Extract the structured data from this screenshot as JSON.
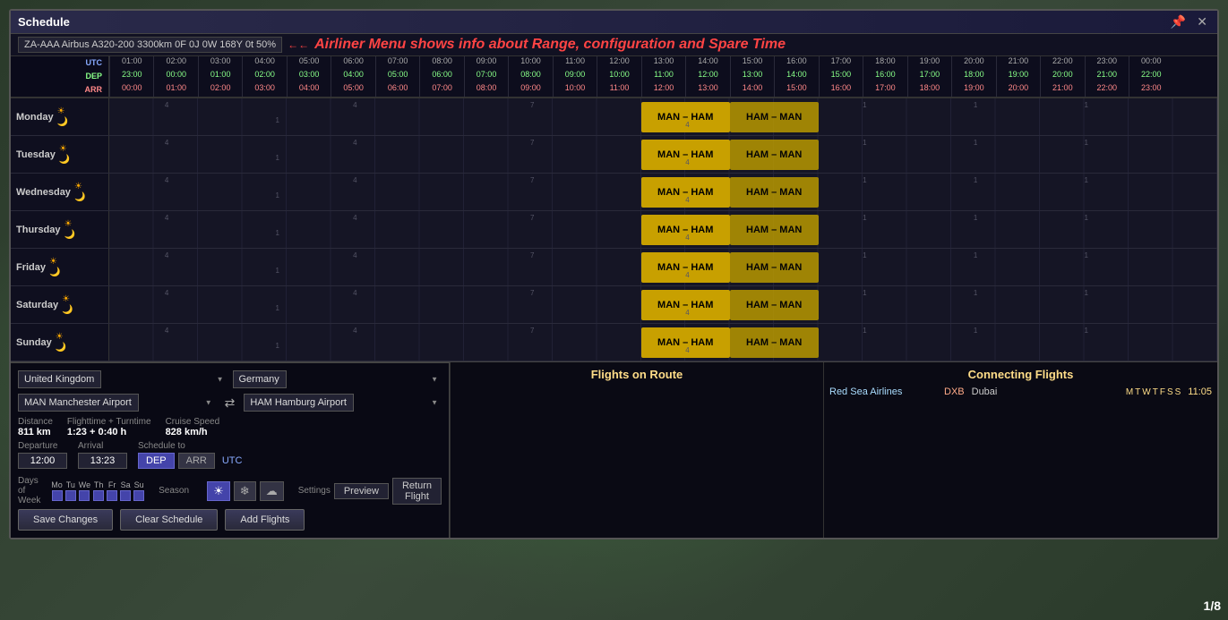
{
  "window": {
    "title": "Schedule",
    "controls": [
      "pin-icon",
      "close-icon"
    ]
  },
  "airliner": {
    "info": "ZA-AAA  Airbus A320-200  3300km  0F 0J 0W 168Y 0t  50%"
  },
  "annotation": {
    "arrow": "←←",
    "text": "Airliner Menu shows info about Range, configuration and Spare Time"
  },
  "time_header": {
    "utc_label": "UTC",
    "dep_label": "DEP",
    "arr_label": "ARR",
    "times": [
      {
        "utc": "01:00",
        "dep": "23:00",
        "arr": "00:00"
      },
      {
        "utc": "02:00",
        "dep": "00:00",
        "arr": "01:00"
      },
      {
        "utc": "03:00",
        "dep": "01:00",
        "arr": "02:00"
      },
      {
        "utc": "04:00",
        "dep": "02:00",
        "arr": "03:00"
      },
      {
        "utc": "05:00",
        "dep": "03:00",
        "arr": "04:00"
      },
      {
        "utc": "06:00",
        "dep": "04:00",
        "arr": "05:00"
      },
      {
        "utc": "07:00",
        "dep": "05:00",
        "arr": "06:00"
      },
      {
        "utc": "08:00",
        "dep": "06:00",
        "arr": "07:00"
      },
      {
        "utc": "09:00",
        "dep": "07:00",
        "arr": "08:00"
      },
      {
        "utc": "10:00",
        "dep": "08:00",
        "arr": "09:00"
      },
      {
        "utc": "11:00",
        "dep": "09:00",
        "arr": "10:00"
      },
      {
        "utc": "12:00",
        "dep": "10:00",
        "arr": "11:00"
      },
      {
        "utc": "13:00",
        "dep": "11:00",
        "arr": "12:00"
      },
      {
        "utc": "14:00",
        "dep": "12:00",
        "arr": "13:00"
      },
      {
        "utc": "15:00",
        "dep": "13:00",
        "arr": "14:00"
      },
      {
        "utc": "16:00",
        "dep": "14:00",
        "arr": "15:00"
      },
      {
        "utc": "17:00",
        "dep": "15:00",
        "arr": "16:00"
      },
      {
        "utc": "18:00",
        "dep": "16:00",
        "arr": "17:00"
      },
      {
        "utc": "19:00",
        "dep": "17:00",
        "arr": "18:00"
      },
      {
        "utc": "20:00",
        "dep": "18:00",
        "arr": "19:00"
      },
      {
        "utc": "21:00",
        "dep": "19:00",
        "arr": "20:00"
      },
      {
        "utc": "22:00",
        "dep": "20:00",
        "arr": "21:00"
      },
      {
        "utc": "23:00",
        "dep": "21:00",
        "arr": "22:00"
      },
      {
        "utc": "00:00",
        "dep": "22:00",
        "arr": "23:00"
      }
    ]
  },
  "days": [
    {
      "name": "Monday",
      "flight_out": "MAN – HAM",
      "flight_ret": "HAM – MAN"
    },
    {
      "name": "Tuesday",
      "flight_out": "MAN – HAM",
      "flight_ret": "HAM – MAN"
    },
    {
      "name": "Wednesday",
      "flight_out": "MAN – HAM",
      "flight_ret": "HAM – MAN"
    },
    {
      "name": "Thursday",
      "flight_out": "MAN – HAM",
      "flight_ret": "HAM – MAN"
    },
    {
      "name": "Friday",
      "flight_out": "MAN – HAM",
      "flight_ret": "HAM – MAN"
    },
    {
      "name": "Saturday",
      "flight_out": "MAN – HAM",
      "flight_ret": "HAM – MAN"
    },
    {
      "name": "Sunday",
      "flight_out": "MAN – HAM",
      "flight_ret": "HAM – MAN"
    }
  ],
  "bottom_panel": {
    "origin_country": "United Kingdom",
    "dest_country": "Germany",
    "origin_airport": "MAN  Manchester Airport",
    "dest_airport": "HAM  Hamburg Airport",
    "distance_label": "Distance",
    "distance_value": "811 km",
    "flighttime_label": "Flighttime + Turntime",
    "flighttime_value": "1:23 + 0:40 h",
    "cruise_speed_label": "Cruise Speed",
    "cruise_speed_value": "828 km/h",
    "departure_label": "Departure",
    "departure_value": "12:00",
    "arrival_label": "Arrival",
    "arrival_value": "13:23",
    "schedule_to_label": "Schedule to",
    "dep_btn": "DEP",
    "arr_btn": "ARR",
    "utc_btn": "UTC",
    "days_label": "Days of Week",
    "days": [
      "Mo",
      "Tu",
      "We",
      "Th",
      "Fr",
      "Sa",
      "Su"
    ],
    "season_label": "Season",
    "season_buttons": [
      "☀",
      "❄",
      "☁"
    ],
    "settings_label": "Settings",
    "preview_btn": "Preview",
    "return_flight_btn": "Return Flight",
    "save_btn": "Save Changes",
    "clear_btn": "Clear Schedule",
    "add_btn": "Add Flights"
  },
  "flights_on_route": {
    "title": "Flights on Route"
  },
  "connecting_flights": {
    "title": "Connecting Flights",
    "flights": [
      {
        "airline": "Red Sea Airlines",
        "code": "DXB",
        "city": "Dubai",
        "days": [
          "M",
          "T",
          "W",
          "T",
          "F",
          "S",
          "S"
        ],
        "active_days": [
          0,
          1,
          2,
          3,
          4,
          5,
          6
        ],
        "time": "11:05"
      }
    ]
  },
  "page_counter": "1/8"
}
